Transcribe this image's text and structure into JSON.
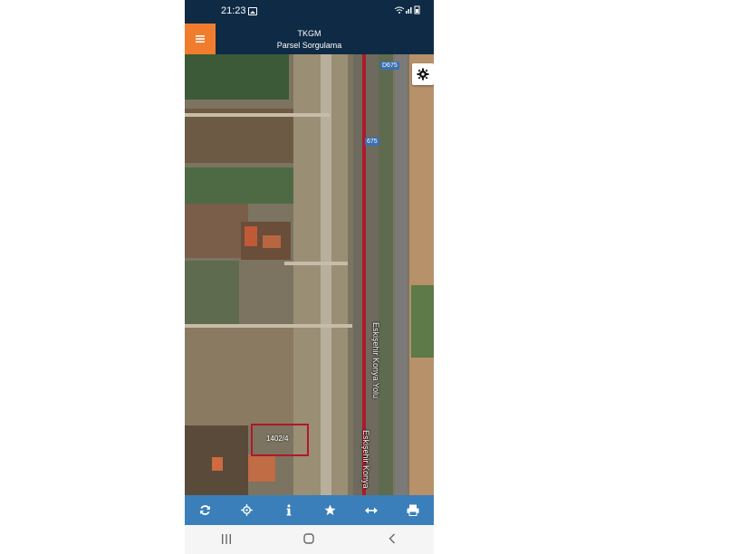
{
  "status_bar": {
    "time": "21:23",
    "indicators": "wifi signal battery"
  },
  "app_bar": {
    "title": "TKGM",
    "subtitle": "Parsel Sorgulama",
    "menu_icon": "menu-icon"
  },
  "map": {
    "settings_icon": "gear-icon",
    "road_shield_top": "D675",
    "road_shield_mid": "675",
    "road_label_1": "Eskişehir Konya Yolu",
    "road_label_2": "Eskişehir Konya",
    "parcel_label": "1402/4",
    "parcel_color": "#b0182a"
  },
  "toolbar": {
    "accent": "#3a7fb9",
    "buttons": [
      "refresh-icon",
      "locate-icon",
      "info-icon",
      "star-icon",
      "measure-icon",
      "print-icon"
    ]
  },
  "nav_bar": {
    "buttons": [
      "recent-apps-icon",
      "home-icon",
      "back-icon"
    ]
  }
}
